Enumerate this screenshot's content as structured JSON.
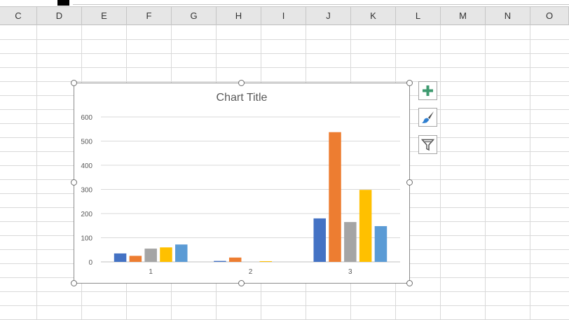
{
  "columns": [
    "C",
    "D",
    "E",
    "F",
    "G",
    "H",
    "I",
    "J",
    "K",
    "L",
    "M",
    "N",
    "O"
  ],
  "chart_buttons": {
    "elements": "plus-icon",
    "styles": "paintbrush-icon",
    "filters": "funnel-icon"
  },
  "chart_data": {
    "type": "bar",
    "title": "Chart Title",
    "categories": [
      "1",
      "2",
      "3"
    ],
    "yticks": [
      "0",
      "100",
      "200",
      "300",
      "400",
      "500",
      "600"
    ],
    "ylim": [
      0,
      600
    ],
    "grid": true,
    "series": [
      {
        "values": [
          35,
          4,
          180
        ],
        "color": "#4472C4"
      },
      {
        "values": [
          25,
          18,
          537
        ],
        "color": "#ED7D31"
      },
      {
        "values": [
          55,
          0,
          165
        ],
        "color": "#A5A5A5"
      },
      {
        "values": [
          60,
          3,
          298
        ],
        "color": "#FFC000"
      },
      {
        "values": [
          72,
          0,
          148
        ],
        "color": "#5B9BD5"
      }
    ]
  }
}
